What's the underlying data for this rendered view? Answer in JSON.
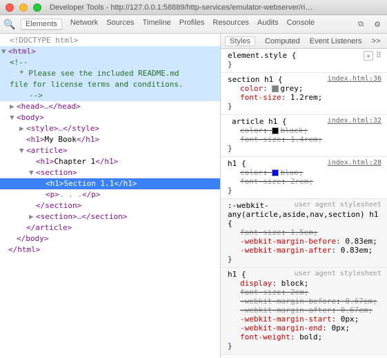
{
  "title": "Developer Tools - http://127.0.0.1:58889/http-services/emulator-webserver/ri…",
  "toolbar": {
    "tabs": [
      "Elements",
      "Network",
      "Sources",
      "Timeline",
      "Profiles",
      "Resources",
      "Audits",
      "Console"
    ],
    "active": "Elements"
  },
  "tree": {
    "doctype": "<!DOCTYPE html>",
    "html_open": "html",
    "comment_open": "<!--",
    "comment_l1": "* Please see the included README.md",
    "comment_l2": "file for license terms and conditions.",
    "comment_close": "-->",
    "head": {
      "open": "head",
      "dots": "…",
      "close": "head"
    },
    "body_open": "body",
    "style": {
      "open": "style",
      "dots": "…",
      "close": "style"
    },
    "h1_book": {
      "tag": "h1",
      "text": "My Book"
    },
    "article_open": "article",
    "h1_chap": {
      "tag": "h1",
      "text": "Chapter 1"
    },
    "section_open": "section",
    "h1_sec": {
      "tag": "h1",
      "text": "Section 1.1"
    },
    "p": {
      "tag": "p",
      "dots": ". . ."
    },
    "section_close": "section",
    "section2": {
      "open": "section",
      "dots": "…",
      "close": "section"
    },
    "article_close": "article",
    "body_close": "body",
    "html_close": "html"
  },
  "rtabs": [
    "Styles",
    "Computed",
    "Event Listeners"
  ],
  "rtabs_active": "Styles",
  "rules": {
    "r0": {
      "sel": "element.style {",
      "close": "}"
    },
    "r1": {
      "sel": "section h1 {",
      "link": "index.html:36",
      "p1n": "color",
      "p1v": "grey;",
      "p2n": "font-size",
      "p2v": "1.2rem;",
      "close": "}"
    },
    "r2": {
      "sel": "article h1 {",
      "link": "index.html:32",
      "p1n": "color",
      "p1v": "black;",
      "p2n": "font-size",
      "p2v": "1.4rem;",
      "close": "}"
    },
    "r3": {
      "sel": "h1 {",
      "link": "index.html:28",
      "p1n": "color",
      "p1v": "blue;",
      "p2n": "font-size",
      "p2v": "2rem;",
      "close": "}"
    },
    "r4": {
      "sel1": ":-webkit-",
      "sel2": "any(article,aside,nav,section) h1 {",
      "ua": "user agent stylesheet",
      "p1n": "font-size",
      "p1v": "1.5em;",
      "p2n": "-webkit-margin-before",
      "p2v": "0.83em;",
      "p3n": "-webkit-margin-after",
      "p3v": "0.83em;",
      "close": "}"
    },
    "r5": {
      "sel": "h1 {",
      "ua": "user agent stylesheet",
      "p1n": "display",
      "p1v": "block;",
      "p2n": "font-size",
      "p2v": "2em;",
      "p3n": "-webkit-margin-before",
      "p3v": "0.67em;",
      "p4n": "-webkit-margin-after",
      "p4v": "0.67em;",
      "p5n": "-webkit-margin-start",
      "p5v": "0px;",
      "p6n": "-webkit-margin-end",
      "p6v": "0px;",
      "p7n": "font-weight",
      "p7v": "bold;",
      "close": "}"
    }
  },
  "arrows": ">>"
}
